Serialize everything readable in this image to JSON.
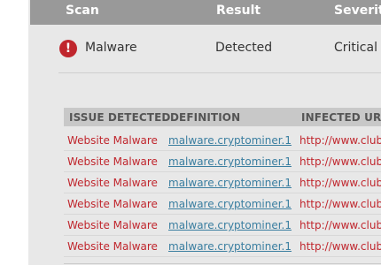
{
  "scan_table": {
    "headers": {
      "scan": "Scan",
      "result": "Result",
      "severity": "Severity"
    },
    "row": {
      "scan": "Malware",
      "result": "Detected",
      "severity": "Critical",
      "icon": "alert-icon"
    }
  },
  "issues_table": {
    "headers": {
      "issue": "ISSUE DETECTED",
      "definition": "DEFINITION",
      "url": "INFECTED URL"
    },
    "rows": [
      {
        "issue": "Website Malware",
        "definition": "malware.cryptominer.1",
        "url": "http://www.club"
      },
      {
        "issue": "Website Malware",
        "definition": "malware.cryptominer.1",
        "url": "http://www.club"
      },
      {
        "issue": "Website Malware",
        "definition": "malware.cryptominer.1",
        "url": "http://www.club"
      },
      {
        "issue": "Website Malware",
        "definition": "malware.cryptominer.1",
        "url": "http://www.club"
      },
      {
        "issue": "Website Malware",
        "definition": "malware.cryptominer.1",
        "url": "http://www.club"
      },
      {
        "issue": "Website Malware",
        "definition": "malware.cryptominer.1",
        "url": "http://www.club"
      }
    ]
  },
  "colors": {
    "critical": "#c0262d",
    "link": "#3a7ea0",
    "header_bg": "#999999"
  }
}
